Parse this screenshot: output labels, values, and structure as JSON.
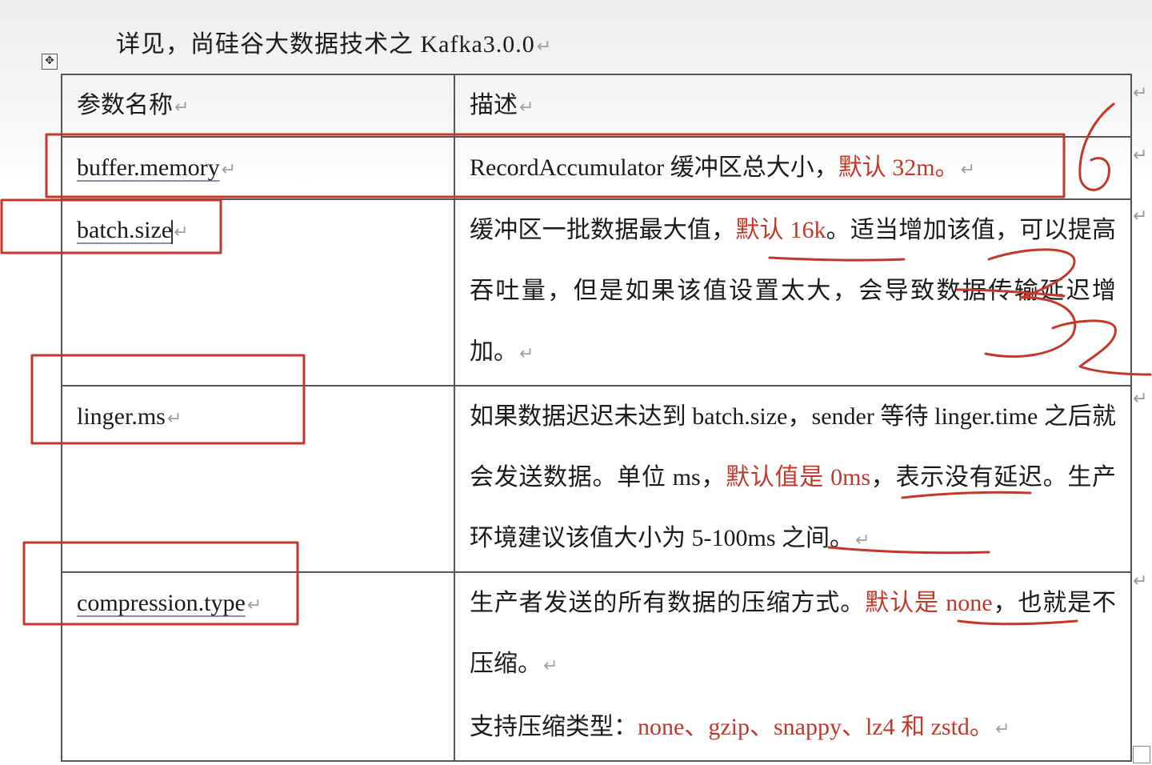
{
  "heading": {
    "text": "详见，尚硅谷大数据技术之 Kafka3.0.0",
    "mark": "↵"
  },
  "table": {
    "header": {
      "name": "参数名称",
      "desc": "描述"
    },
    "rows": [
      {
        "name": "buffer.memory",
        "desc_plain": "RecordAccumulator 缓冲区总大小，",
        "desc_red": "默认 32m。"
      },
      {
        "name": "batch.size",
        "desc_a": "缓冲区一批数据最大值，",
        "desc_red": "默认 16k",
        "desc_b": "。适当增加该值，可以提高吞吐量，但是如果该值设置太大，会导致数据传输延迟增加。"
      },
      {
        "name": "linger.ms",
        "desc_a": "如果数据迟迟未达到 batch.size，sender 等待 linger.time 之后就会发送数据。单位 ms，",
        "desc_red": "默认值是 0ms",
        "desc_b": "，表示没有延迟。生产环境建议该值大小为 5-100ms 之间。"
      },
      {
        "name": "compression.type",
        "desc_a": "生产者发送的所有数据的压缩方式。",
        "desc_red": "默认是 none",
        "desc_b": "，也就是不压缩。",
        "desc2_label": "支持压缩类型：",
        "desc2_red": "none、gzip、snappy、lz4 和 zstd。"
      }
    ]
  },
  "annotations": {
    "numerals": [
      "6",
      "3",
      "2"
    ],
    "color": "#c0392b"
  },
  "ui": {
    "table_anchor_icon": "move-handle-icon",
    "paragraph_mark": "↵"
  }
}
